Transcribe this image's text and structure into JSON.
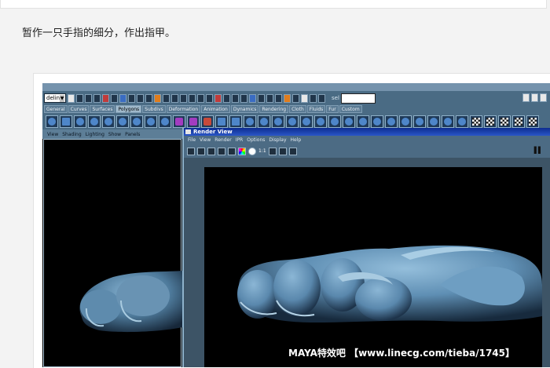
{
  "post": {
    "text": "暂作一只手指的细分，作出指甲。"
  },
  "maya": {
    "mode_select": "deling",
    "select_label": "sel",
    "tabs": [
      "General",
      "Curves",
      "Surfaces",
      "Polygons",
      "Subdivs",
      "Deformation",
      "Animation",
      "Dynamics",
      "Rendering",
      "Cloth",
      "Fluids",
      "Fur",
      "Custom"
    ],
    "active_tab": "Polygons",
    "viewport_menu": [
      "View",
      "Shading",
      "Lighting",
      "Show",
      "Panels"
    ],
    "render_view": {
      "title": "Render View",
      "menu": [
        "File",
        "View",
        "Render",
        "IPR",
        "Options",
        "Display",
        "Help"
      ],
      "toolbar_text": "1:1"
    }
  },
  "watermark": "MAYA特效吧 【www.linecg.com/tieba/1745】",
  "colors": {
    "maya_bg": "#3e6079",
    "render_bg": "#000000",
    "model": "#5f8fb4",
    "titlebar": "#0e2d8f"
  }
}
